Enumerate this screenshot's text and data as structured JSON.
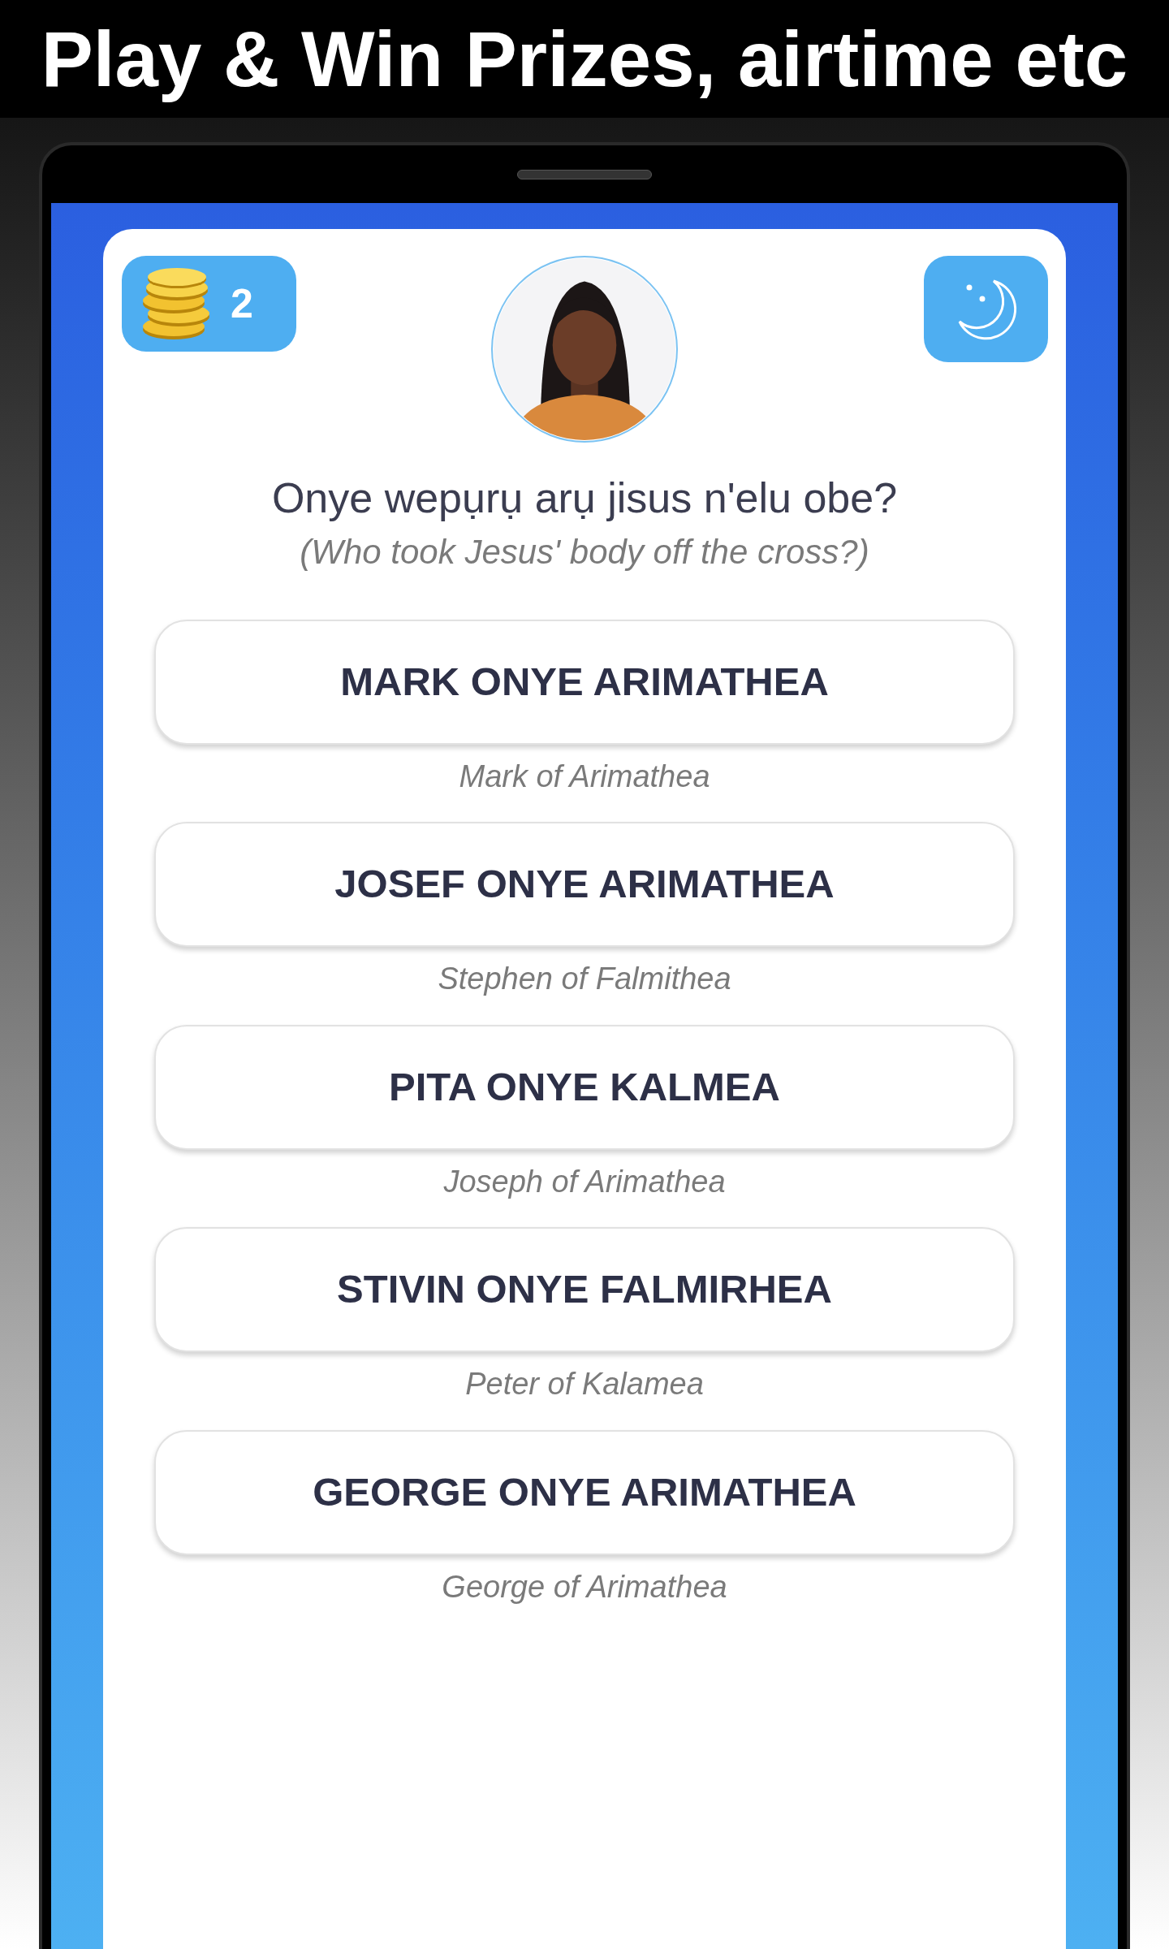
{
  "banner": {
    "title": "Play & Win Prizes, airtime etc"
  },
  "header": {
    "coins": "2"
  },
  "question": {
    "text": "Onye wepụrụ arụ jisus n'elu obe?",
    "translation": "(Who took Jesus' body off the cross?)"
  },
  "options": [
    {
      "label": "MARK ONYE ARIMATHEA",
      "translation": "Mark of Arimathea"
    },
    {
      "label": "JOSEF ONYE ARIMATHEA",
      "translation": "Stephen of Falmithea"
    },
    {
      "label": "PITA ONYE KALMEA",
      "translation": "Joseph of Arimathea"
    },
    {
      "label": "STIVIN ONYE FALMIRHEA",
      "translation": "Peter of Kalamea"
    },
    {
      "label": "GEORGE ONYE ARIMATHEA",
      "translation": "George of Arimathea"
    }
  ]
}
